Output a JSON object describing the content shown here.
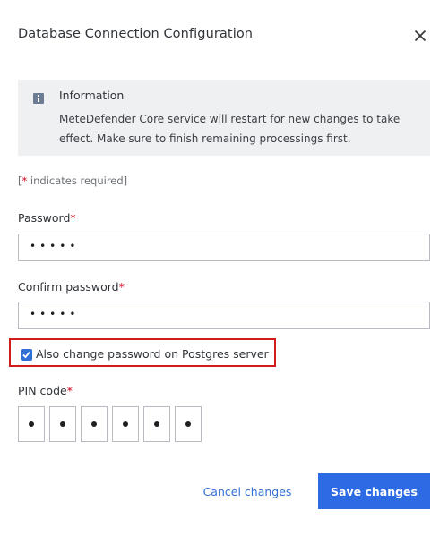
{
  "dialog": {
    "title": "Database Connection Configuration",
    "close_icon": "close-icon"
  },
  "info": {
    "icon": "info-icon",
    "title": "Information",
    "text": "MeteDefender Core service will restart for new changes to take effect. Make sure to finish remaining processings first."
  },
  "required_note": {
    "prefix": "[",
    "star": "*",
    "suffix": " indicates required]"
  },
  "fields": {
    "password": {
      "label": "Password",
      "star": "*",
      "value": "•••••"
    },
    "confirm_password": {
      "label": "Confirm password",
      "star": "*",
      "value": "•••••"
    }
  },
  "checkbox": {
    "label": "Also change password on Postgres server",
    "checked": true
  },
  "pin": {
    "label": "PIN code",
    "star": "*",
    "digits": [
      "•",
      "•",
      "•",
      "•",
      "•",
      "•"
    ]
  },
  "buttons": {
    "cancel": "Cancel changes",
    "save": "Save changes"
  },
  "colors": {
    "accent": "#2d6be5",
    "required": "#d0021b",
    "highlight_border": "#d11a1a",
    "info_bg": "#eef0f2"
  }
}
